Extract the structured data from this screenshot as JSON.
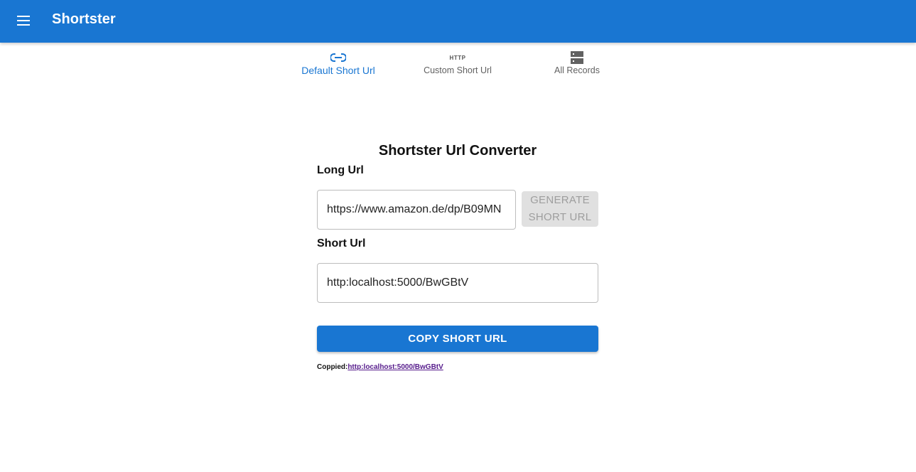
{
  "app": {
    "title": "Shortster"
  },
  "tabs": [
    {
      "label": "Default Short Url",
      "icon": "link-icon",
      "active": true
    },
    {
      "label": "Custom Short Url",
      "icon": "http-icon",
      "active": false
    },
    {
      "label": "All Records",
      "icon": "storage-icon",
      "active": false
    }
  ],
  "http_icon_text": "HTTP",
  "converter": {
    "heading": "Shortster Url Converter",
    "long_label": "Long Url",
    "long_value": "https://www.amazon.de/dp/B09MN",
    "generate_label": "Generate Short Url",
    "short_label": "Short Url",
    "short_value": "http:localhost:5000/BwGBtV",
    "copy_label": "COPY SHORT URL",
    "copied_prefix": "Coppied:",
    "copied_link": "http:localhost:5000/BwGBtV"
  },
  "colors": {
    "primary": "#1976d2",
    "disabled_bg": "#e0e0e0",
    "disabled_text": "#9e9e9e",
    "visited_link": "#551a8b"
  }
}
